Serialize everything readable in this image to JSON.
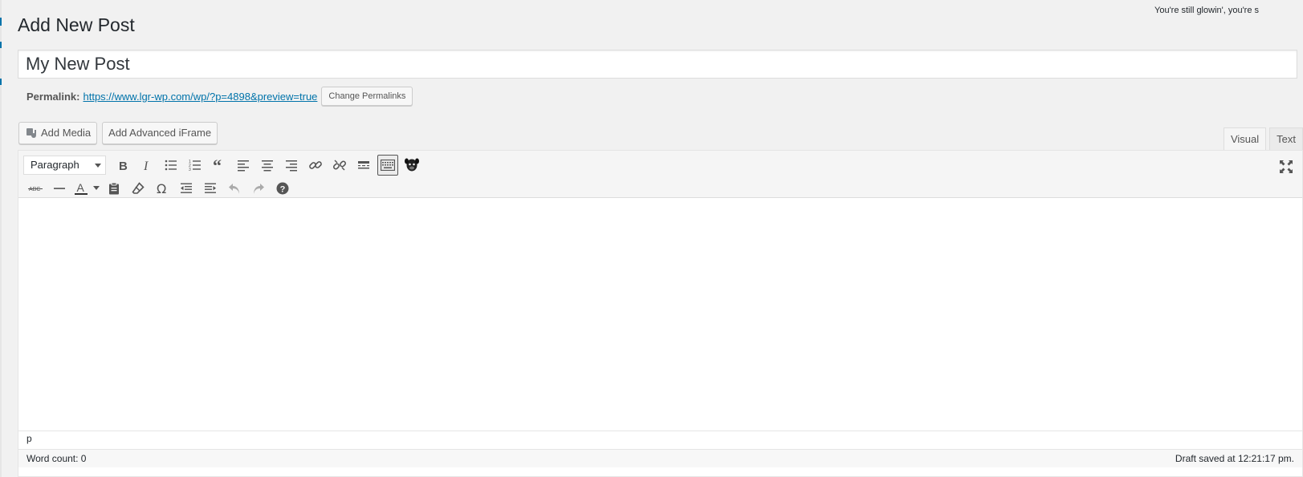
{
  "dolly": "You're still glowin', you're s",
  "page": {
    "title": "Add New Post"
  },
  "post": {
    "title": "My New Post"
  },
  "permalink": {
    "label": "Permalink:",
    "url": "https://www.lgr-wp.com/wp/?p=4898&preview=true",
    "change_button": "Change Permalinks"
  },
  "media": {
    "add_media": "Add Media",
    "add_iframe": "Add Advanced iFrame"
  },
  "editor_tabs": [
    {
      "label": "Visual",
      "active": true
    },
    {
      "label": "Text",
      "active": false
    }
  ],
  "toolbar": {
    "format_value": "Paragraph",
    "row1_icons": [
      "bold-icon",
      "italic-icon",
      "bulleted-list-icon",
      "numbered-list-icon",
      "blockquote-icon",
      "align-left-icon",
      "align-center-icon",
      "align-right-icon",
      "link-icon",
      "unlink-icon",
      "read-more-icon",
      "toolbar-toggle-icon",
      "pug-icon"
    ],
    "row2_icons": [
      "strikethrough-icon",
      "horizontal-line-icon",
      "text-color-icon",
      "paste-as-text-icon",
      "clear-formatting-icon",
      "special-character-icon",
      "outdent-icon",
      "indent-icon",
      "undo-icon",
      "redo-icon",
      "help-icon"
    ],
    "text_color_letter": "A",
    "strikethrough_text": "ABC",
    "omega": "Ω"
  },
  "editor": {
    "path": "p"
  },
  "status": {
    "word_count": "Word count: 0",
    "draft_saved": "Draft saved at 12:21:17 pm."
  }
}
